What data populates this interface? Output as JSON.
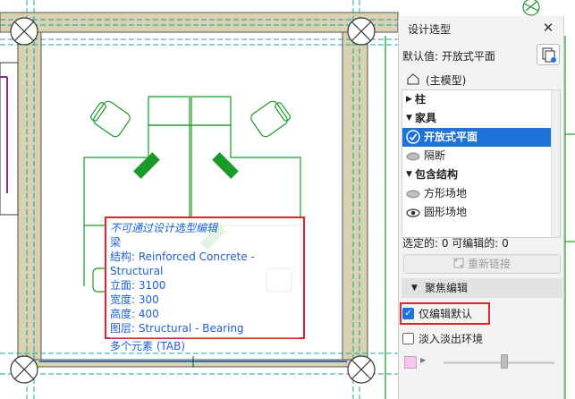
{
  "tooltip": {
    "warning": "不可通过设计选型编辑",
    "element_type": "梁",
    "structure": "结构: Reinforced Concrete - Structural",
    "elevation": "立面: 3100",
    "width": "宽度: 300",
    "height": "高度: 400",
    "layer": "图层: Structural - Bearing",
    "multiple": "多个元素 (TAB)"
  },
  "panel": {
    "title": "设计选型",
    "close_symbol": "✕",
    "default_value": "默认值: 开放式平面",
    "main_model": "(主模型)",
    "groups": [
      {
        "label": "柱",
        "expanded": false
      },
      {
        "label": "家具",
        "expanded": true
      },
      {
        "label": "包含结构",
        "expanded": true
      }
    ],
    "items": {
      "open_plan": "开放式平面",
      "partition": "隔断",
      "square_site": "方形场地",
      "round_site": "圆形场地"
    },
    "selected_item": "开放式平面",
    "count_text": "选定的: 0 可编辑的:  0",
    "relink_button": "重新链接",
    "focus_section": "聚焦编辑",
    "edit_default_only": {
      "label": "仅编辑默认",
      "checked": true
    },
    "fade_environment": {
      "label": "淡入淡出环境",
      "checked": false
    },
    "fade_level": 0.55,
    "colors": {
      "accent": "#1e73d8",
      "highlight": "#e0252a",
      "plan_green": "#1a9a2a",
      "wall_fill": "#d9d2b0"
    }
  }
}
